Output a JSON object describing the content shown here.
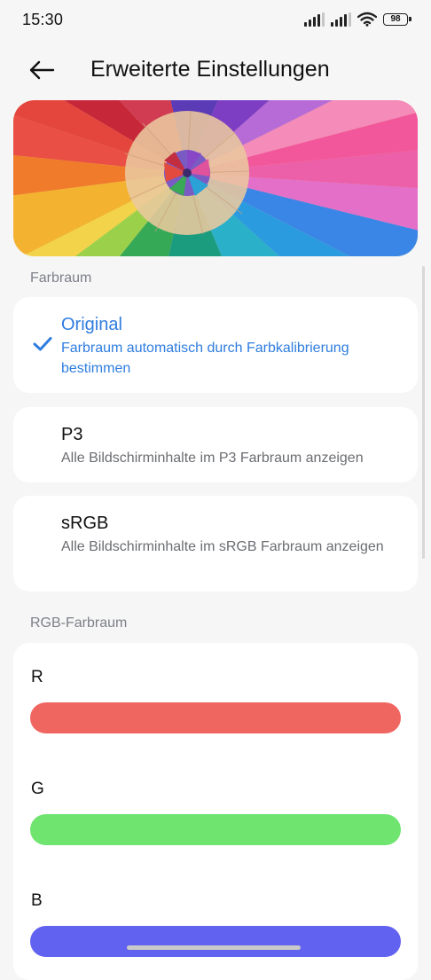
{
  "status": {
    "time": "15:30",
    "battery": "98",
    "icons": [
      "signal-icon",
      "signal-icon",
      "wifi-icon",
      "battery-icon"
    ]
  },
  "header": {
    "back_icon": "arrow-left-icon",
    "title": "Erweiterte Einstellungen"
  },
  "hero": {
    "image": "colored-pencils-image"
  },
  "farbraum": {
    "section_label": "Farbraum",
    "options": [
      {
        "title": "Original",
        "subtitle": "Farbraum automatisch durch Farbkalibrierung bestimmen",
        "selected": true
      },
      {
        "title": "P3",
        "subtitle": "Alle Bildschirminhalte im P3 Farbraum anzeigen",
        "selected": false
      },
      {
        "title": "sRGB",
        "subtitle": "Alle Bildschirminhalte im sRGB Farbraum anzeigen",
        "selected": false
      }
    ]
  },
  "rgb": {
    "section_label": "RGB-Farbraum",
    "channels": [
      {
        "label": "R",
        "color": "#ef6661"
      },
      {
        "label": "G",
        "color": "#6fe46f"
      },
      {
        "label": "B",
        "color": "#6262f0"
      }
    ]
  },
  "colors": {
    "accent": "#2f7ddf",
    "background": "#f6f6f6",
    "card": "#ffffff"
  }
}
